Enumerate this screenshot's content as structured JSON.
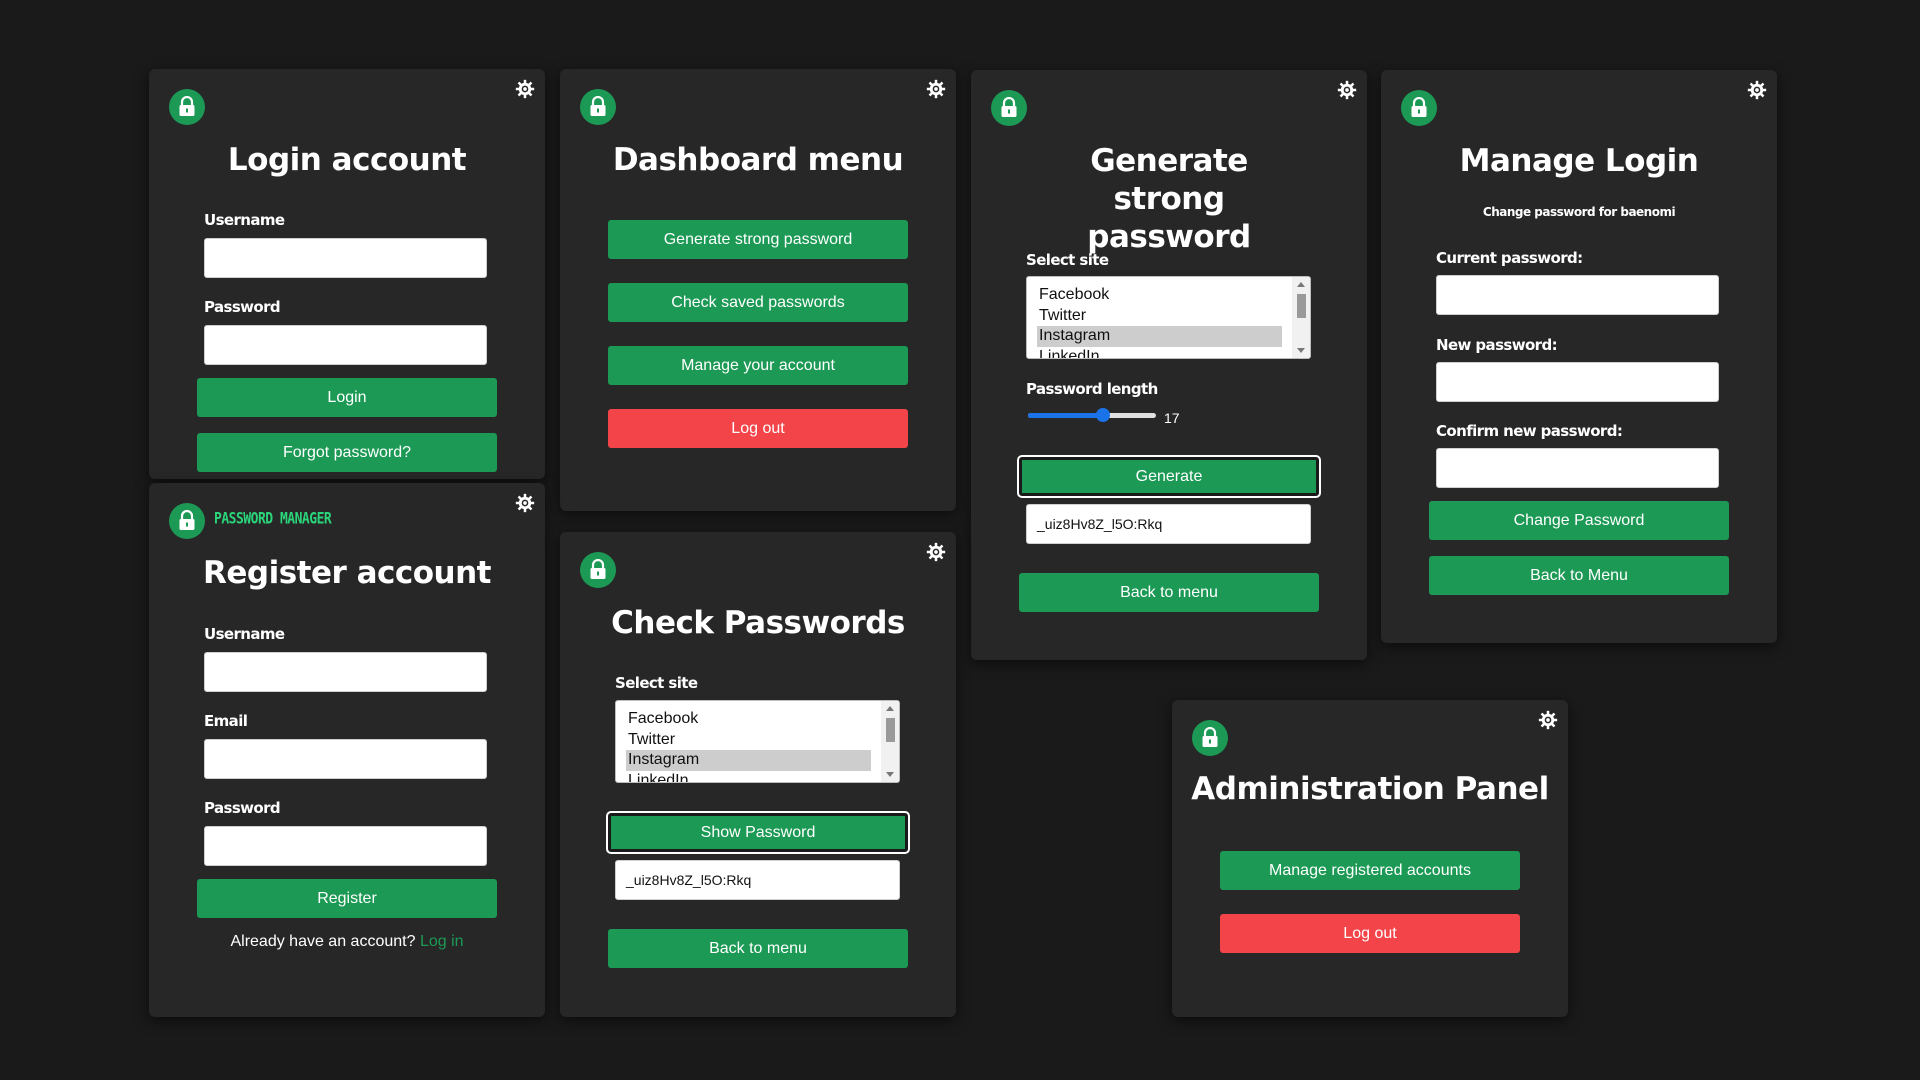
{
  "colors": {
    "background": "#1a1a1a",
    "card": "#272727",
    "primary": "#1c9a55",
    "danger": "#f24449",
    "brand": "#2bd67a",
    "slider": "#1a73e8"
  },
  "icons": {
    "lock": "lock-icon",
    "gear": "gear-icon"
  },
  "login": {
    "title": "Login account",
    "username_label": "Username",
    "password_label": "Password",
    "login_button": "Login",
    "forgot_button": "Forgot password?"
  },
  "dashboard": {
    "title": "Dashboard menu",
    "buttons": [
      "Generate strong password",
      "Check saved passwords",
      "Manage your account",
      "Log out"
    ]
  },
  "generate": {
    "title": "Generate strong password",
    "select_label": "Select site",
    "sites": [
      "Facebook",
      "Twitter",
      "Instagram",
      "LinkedIn"
    ],
    "selected_site": "Instagram",
    "length_label": "Password length",
    "length_value": "17",
    "length_fraction": 0.6,
    "generate_button": "Generate",
    "generated_password": "_uiz8Hv8Z_l5O:Rkq",
    "back_button": "Back to menu"
  },
  "manage": {
    "title": "Manage Login",
    "subtitle": "Change password for baenomi",
    "current_label": "Current password:",
    "new_label": "New password:",
    "confirm_label": "Confirm new password:",
    "change_button": "Change Password",
    "back_button": "Back to Menu"
  },
  "register": {
    "brand": "PASSWORD MANAGER",
    "title": "Register account",
    "username_label": "Username",
    "email_label": "Email",
    "password_label": "Password",
    "register_button": "Register",
    "have_account_text": "Already have an account?",
    "login_link": "Log in"
  },
  "check": {
    "title": "Check Passwords",
    "select_label": "Select site",
    "sites": [
      "Facebook",
      "Twitter",
      "Instagram",
      "LinkedIn"
    ],
    "selected_site": "Instagram",
    "show_button": "Show Password",
    "password_value": "_uiz8Hv8Z_l5O:Rkq",
    "back_button": "Back to menu"
  },
  "admin": {
    "title": "Administration Panel",
    "manage_button": "Manage registered accounts",
    "logout_button": "Log out"
  }
}
